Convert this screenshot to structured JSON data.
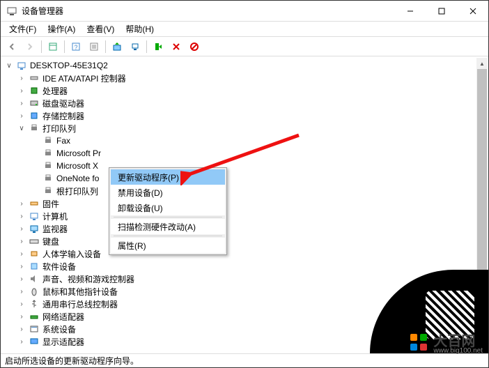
{
  "window": {
    "title": "设备管理器"
  },
  "menubar": {
    "file": "文件(F)",
    "action": "操作(A)",
    "view": "查看(V)",
    "help": "帮助(H)"
  },
  "tree": {
    "root": "DESKTOP-45E31Q2",
    "categories": [
      {
        "label": "IDE ATA/ATAPI 控制器",
        "expanded": false,
        "icon": "ide"
      },
      {
        "label": "处理器",
        "expanded": false,
        "icon": "cpu"
      },
      {
        "label": "磁盘驱动器",
        "expanded": false,
        "icon": "disk"
      },
      {
        "label": "存储控制器",
        "expanded": false,
        "icon": "storage"
      },
      {
        "label": "打印队列",
        "expanded": true,
        "icon": "printer",
        "children": [
          {
            "label": "Fax"
          },
          {
            "label": "Microsoft Pr",
            "selected": true
          },
          {
            "label": "Microsoft X"
          },
          {
            "label": "OneNote fo"
          },
          {
            "label": "根打印队列"
          }
        ]
      },
      {
        "label": "固件",
        "expanded": false,
        "icon": "firmware"
      },
      {
        "label": "计算机",
        "expanded": false,
        "icon": "computer"
      },
      {
        "label": "监视器",
        "expanded": false,
        "icon": "monitor"
      },
      {
        "label": "键盘",
        "expanded": false,
        "icon": "keyboard"
      },
      {
        "label": "人体学输入设备",
        "expanded": false,
        "icon": "hid"
      },
      {
        "label": "软件设备",
        "expanded": false,
        "icon": "software"
      },
      {
        "label": "声音、视频和游戏控制器",
        "expanded": false,
        "icon": "sound"
      },
      {
        "label": "鼠标和其他指针设备",
        "expanded": false,
        "icon": "mouse"
      },
      {
        "label": "通用串行总线控制器",
        "expanded": false,
        "icon": "usb"
      },
      {
        "label": "网络适配器",
        "expanded": false,
        "icon": "network"
      },
      {
        "label": "系统设备",
        "expanded": false,
        "icon": "system"
      },
      {
        "label": "显示适配器",
        "expanded": false,
        "icon": "display"
      }
    ]
  },
  "context_menu": {
    "update_driver": "更新驱动程序(P)",
    "disable_device": "禁用设备(D)",
    "uninstall_device": "卸载设备(U)",
    "scan_hardware": "扫描检测硬件改动(A)",
    "properties": "属性(R)"
  },
  "statusbar": {
    "text": "启动所选设备的更新驱动程序向导。"
  },
  "watermark": {
    "brand": "大百网",
    "url": "www.big100.net"
  }
}
